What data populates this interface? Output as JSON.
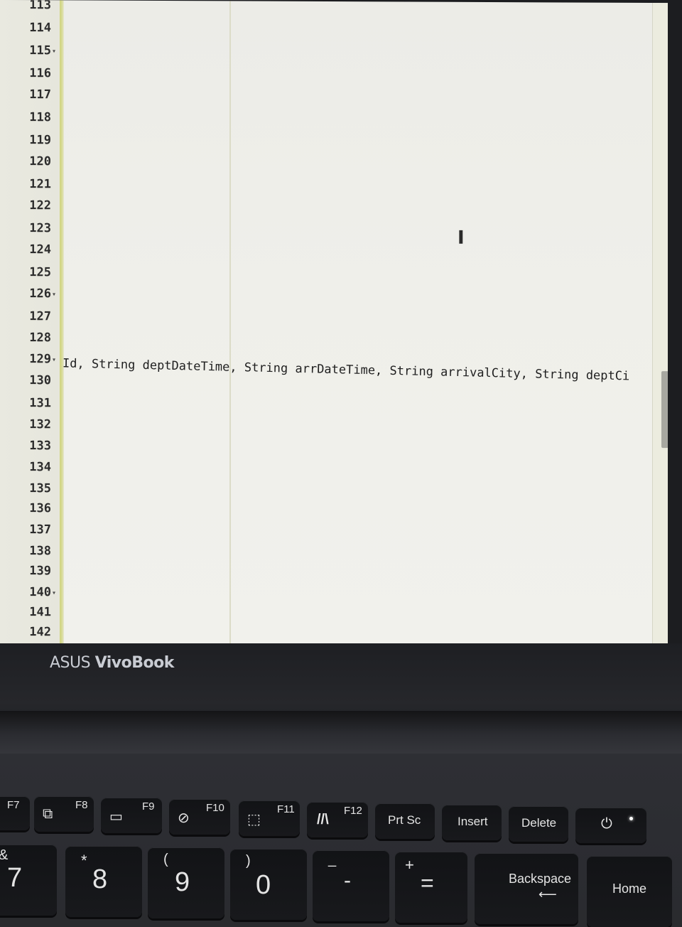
{
  "editor": {
    "line_numbers": [
      "113",
      "114",
      "115",
      "116",
      "117",
      "118",
      "119",
      "120",
      "121",
      "122",
      "123",
      "124",
      "125",
      "126",
      "127",
      "128",
      "129",
      "130",
      "131",
      "132",
      "133",
      "134",
      "135",
      "136",
      "137",
      "138",
      "139",
      "140",
      "141",
      "142"
    ],
    "folded_lines": [
      "115",
      "126",
      "129",
      "140"
    ],
    "code_line_129": "Id, String deptDateTime, String arrDateTime, String arrivalCity, String deptCi",
    "cursor_icon": "text-cursor-icon"
  },
  "laptop": {
    "brand_prefix": "ASUS ",
    "brand_name": "VivoBook"
  },
  "keyboard": {
    "function_keys": [
      {
        "label": "F7",
        "icon": "display-mirror-icon"
      },
      {
        "label": "F8",
        "icon": "projector-icon"
      },
      {
        "label": "F9",
        "icon": "touchpad-lock-icon"
      },
      {
        "label": "F10",
        "icon": "camera-off-icon"
      },
      {
        "label": "F11",
        "icon": "screenshot-icon"
      },
      {
        "label": "F12",
        "icon": "myasus-icon"
      }
    ],
    "prtsc": "Prt Sc",
    "insert": "Insert",
    "delete": "Delete",
    "num_keys": [
      {
        "top": "&",
        "main": "7"
      },
      {
        "top": "*",
        "main": "8"
      },
      {
        "top": "(",
        "main": "9"
      },
      {
        "top": ")",
        "main": "0"
      },
      {
        "top": "_",
        "main": "-"
      },
      {
        "top": "+",
        "main": "="
      }
    ],
    "backspace": "Backspace",
    "home": "Home"
  }
}
